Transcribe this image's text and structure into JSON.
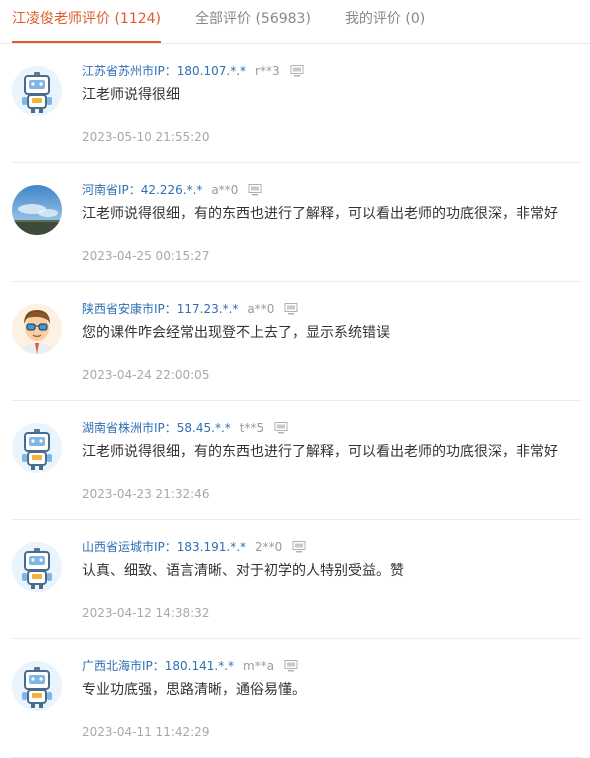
{
  "tabs": [
    {
      "label": "江凌俊老师评价 (1124)",
      "active": true
    },
    {
      "label": "全部评价 (56983)",
      "active": false
    },
    {
      "label": "我的评价 (0)",
      "active": false
    }
  ],
  "accent": "#e05a2b",
  "reviews": [
    {
      "region": "江苏省苏州市IP：180.107.*.*",
      "user": "r**3",
      "content": "江老师说得很细",
      "time": "2023-05-10 21:55:20",
      "avatar": "robot-avatar"
    },
    {
      "region": "河南省IP：42.226.*.*",
      "user": "a**0",
      "content": "江老师说得很细，有的东西也进行了解释，可以看出老师的功底很深，非常好",
      "time": "2023-04-25 00:15:27",
      "avatar": "landscape-avatar"
    },
    {
      "region": "陕西省安康市IP：117.23.*.*",
      "user": "a**0",
      "content": "您的课件咋会经常出现登不上去了，显示系统错误",
      "time": "2023-04-24 22:00:05",
      "avatar": "cartoon-man-avatar"
    },
    {
      "region": "湖南省株洲市IP：58.45.*.*",
      "user": "t**5",
      "content": "江老师说得很细，有的东西也进行了解释，可以看出老师的功底很深，非常好",
      "time": "2023-04-23 21:32:46",
      "avatar": "robot-avatar"
    },
    {
      "region": "山西省运城市IP：183.191.*.*",
      "user": "2**0",
      "content": "认真、细致、语言清晰、对于初学的人特别受益。赞",
      "time": "2023-04-12 14:38:32",
      "avatar": "robot-avatar"
    },
    {
      "region": "广西北海市IP：180.141.*.*",
      "user": "m**a",
      "content": "专业功底强，思路清晰，通俗易懂。",
      "time": "2023-04-11 11:42:29",
      "avatar": "robot-avatar"
    }
  ]
}
